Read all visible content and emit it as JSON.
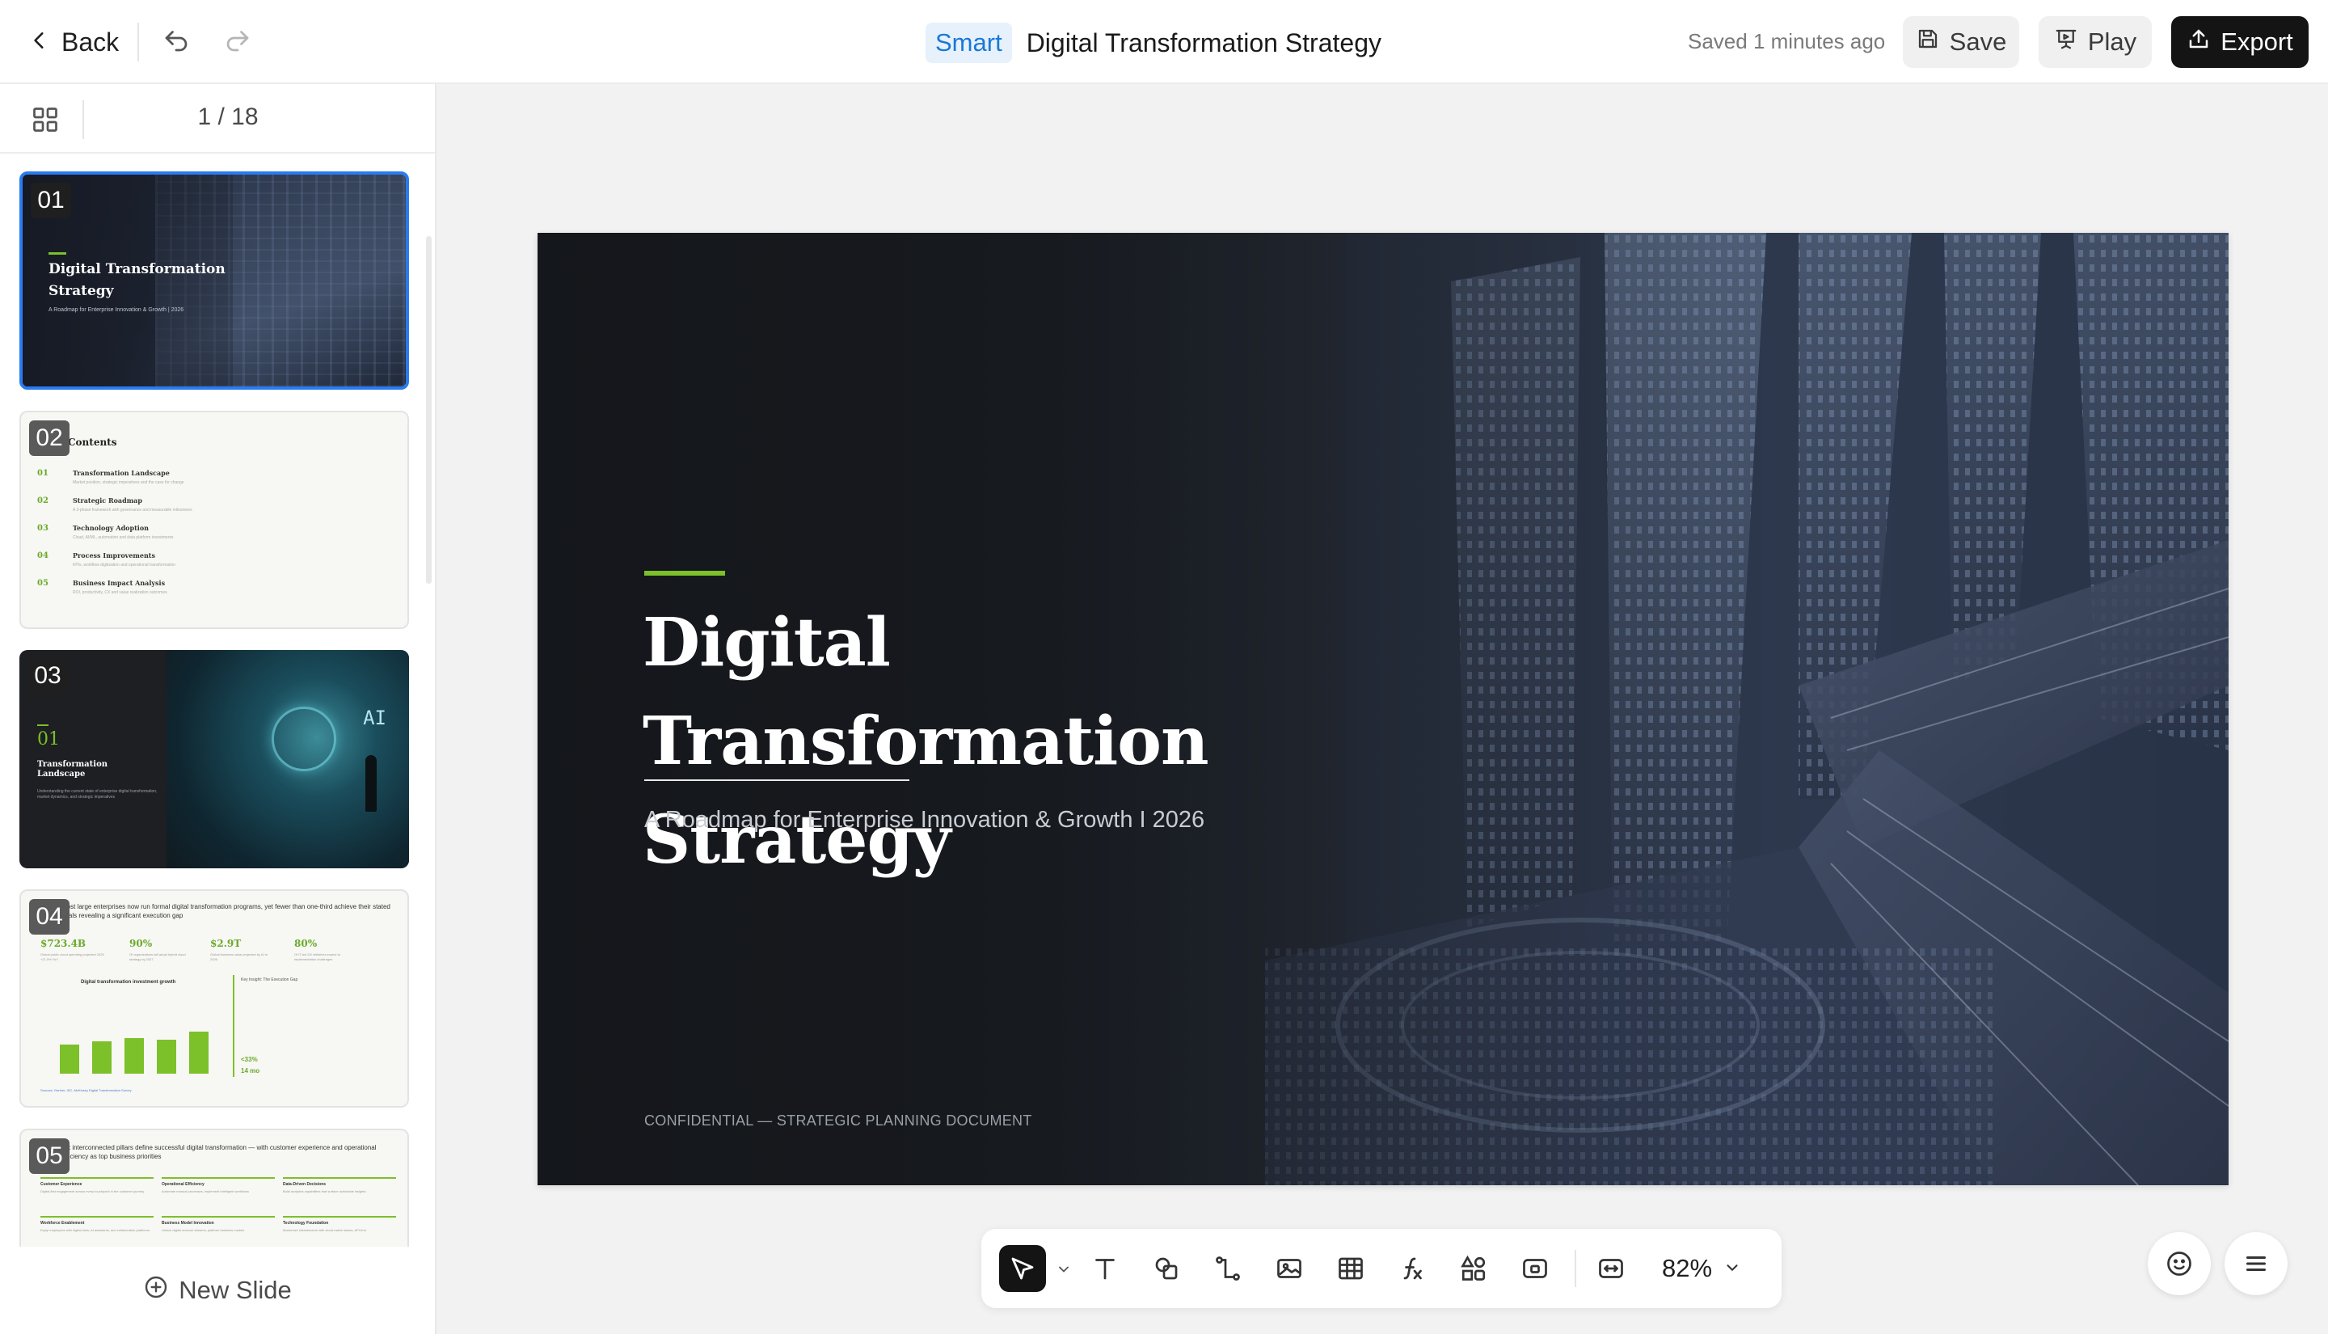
{
  "header": {
    "back_label": "Back",
    "badge": "Smart",
    "title": "Digital Transformation Strategy",
    "saved_status": "Saved 1 minutes ago",
    "save_label": "Save",
    "play_label": "Play",
    "export_label": "Export"
  },
  "sidebar": {
    "page_counter": "1 / 18",
    "new_slide_label": "New Slide",
    "thumbnails": [
      {
        "number": "01",
        "title": "Digital Transformation Strategy",
        "subtitle": "A Roadmap for Enterprise Innovation & Growth | 2026"
      },
      {
        "number": "02",
        "heading": "Contents",
        "items": [
          {
            "num": "01",
            "label": "Transformation Landscape",
            "desc": "Market position, strategic imperatives and the case for change"
          },
          {
            "num": "02",
            "label": "Strategic Roadmap",
            "desc": "A 3-phase framework with governance and measurable milestones"
          },
          {
            "num": "03",
            "label": "Technology Adoption",
            "desc": "Cloud, AI/ML, automation and data platform investments"
          },
          {
            "num": "04",
            "label": "Process Improvements",
            "desc": "KPIs, workflow digitization and operational transformation"
          },
          {
            "num": "05",
            "label": "Business Impact Analysis",
            "desc": "ROI, productivity, CX and value realization outcomes"
          }
        ]
      },
      {
        "number": "03",
        "section_num": "01",
        "title": "Transformation Landscape",
        "desc": "Understanding the current state of enterprise digital transformation, market dynamics, and strategic imperatives",
        "art_label": "AI"
      },
      {
        "number": "04",
        "headline": "Most large enterprises now run formal digital transformation programs, yet fewer than one-third achieve their stated goals revealing a significant execution gap",
        "stats": [
          {
            "value": "$723.4B",
            "desc": "Global public cloud spending projected 2025 +21.5% YoY"
          },
          {
            "value": "90%",
            "desc": "Of organizations will adopt hybrid cloud strategy by 2027"
          },
          {
            "value": "$2.9T",
            "desc": "Global business value projected by AI in 2026"
          },
          {
            "value": "80%",
            "desc": "Of IT-led DX initiatives expect to implementation challenges"
          }
        ],
        "chart_title": "Digital transformation investment growth",
        "insight_title": "Key Insight: The Execution Gap",
        "insight_lines": [
          "<33%",
          "14 mo"
        ],
        "source": "Sources: Gartner, IDC, McKinsey Digital Transformation Survey"
      },
      {
        "number": "05",
        "headline": "Six interconnected pillars define successful digital transformation — with customer experience and operational efficiency as top business priorities",
        "pillars": [
          {
            "title": "Customer Experience",
            "desc": "Digital-first engagement across every touchpoint in the customer journey"
          },
          {
            "title": "Operational Efficiency",
            "desc": "Automate manual processes, implement intelligent workflows"
          },
          {
            "title": "Data-Driven Decisions",
            "desc": "Build analytics capabilities that surface actionable insights"
          },
          {
            "title": "Workforce Enablement",
            "desc": "Equip employees with digital tools, AI assistants, and collaboration platforms"
          },
          {
            "title": "Business Model Innovation",
            "desc": "Unlock digital revenue streams, platform business models"
          },
          {
            "title": "Technology Foundation",
            "desc": "Modernize infrastructure with cloud-native stacks, API-first"
          }
        ]
      }
    ]
  },
  "slide": {
    "title_line1": "Digital Transformation",
    "title_line2": "Strategy",
    "subtitle": "A Roadmap for Enterprise Innovation & Growth I 2026",
    "footer": "CONFIDENTIAL — STRATEGIC PLANNING DOCUMENT",
    "accent_color": "#7cc02a"
  },
  "toolbar": {
    "tools": [
      "select-icon",
      "text-icon",
      "shape-icon",
      "connector-icon",
      "image-icon",
      "table-icon",
      "formula-icon",
      "widgets-icon",
      "media-icon",
      "fit-icon"
    ],
    "zoom": "82%"
  },
  "colors": {
    "selection": "#2a7bf0",
    "accent_green": "#7cc02a",
    "smart_badge_text": "#1a78d6",
    "smart_badge_bg": "#e6f1fc",
    "export_bg": "#141414"
  }
}
